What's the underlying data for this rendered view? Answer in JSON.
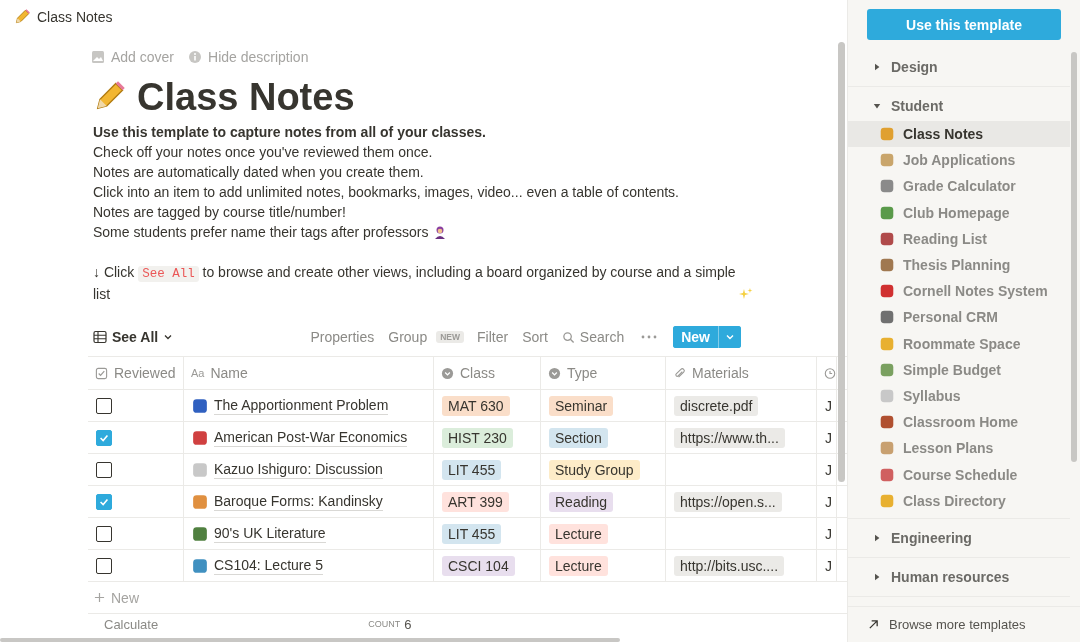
{
  "breadcrumb": {
    "title": "Class Notes"
  },
  "page_actions": [
    "Add cover",
    "Hide description"
  ],
  "page": {
    "title": "Class Notes",
    "description": [
      {
        "kind": "bold",
        "text": "Use this template to capture notes from all of your classes."
      },
      {
        "kind": "plain",
        "text": "Check off your notes once you've reviewed them once."
      },
      {
        "kind": "plain",
        "text": "Notes are automatically dated when you create them."
      },
      {
        "kind": "plain",
        "text": "Click into an item to add unlimited notes, bookmarks, images, video... even a table of contents."
      },
      {
        "kind": "plain",
        "text": "Notes are tagged by course title/number!"
      },
      {
        "kind": "emoji",
        "text": "Some students prefer name their tags after professors"
      },
      {
        "kind": "gap"
      },
      {
        "kind": "code",
        "before": "↓ Click",
        "code": "See All",
        "after": "to browse and create other views, including a board organized by course and a simple list"
      }
    ]
  },
  "view": {
    "name": "See All",
    "toolbar": [
      "Properties",
      "Group",
      "Filter",
      "Sort",
      "Search"
    ],
    "group_badge": "NEW",
    "new_button": "New"
  },
  "table": {
    "columns": [
      {
        "label": "Reviewed",
        "kind": "check"
      },
      {
        "label": "Name",
        "kind": "title",
        "icon_text": "Aa"
      },
      {
        "label": "Class",
        "kind": "select"
      },
      {
        "label": "Type",
        "kind": "select"
      },
      {
        "label": "Materials",
        "kind": "file"
      },
      {
        "kind": "date"
      }
    ],
    "rows": [
      {
        "checked": false,
        "name": "The Apportionment Problem",
        "class": {
          "text": "MAT 630",
          "color": "#fadec9"
        },
        "type": {
          "text": "Seminar",
          "color": "#fadec9"
        },
        "materials": "discrete.pdf",
        "column_5": "J"
      },
      {
        "checked": true,
        "name": "American Post-War Economics",
        "class": {
          "text": "HIST 230",
          "color": "#dbeddb"
        },
        "type": {
          "text": "Section",
          "color": "#d3e5ef"
        },
        "materials": "https://www.th...",
        "column_5": "J"
      },
      {
        "checked": false,
        "name": "Kazuo Ishiguro: Discussion",
        "class": {
          "text": "LIT 455",
          "color": "#d3e5ef"
        },
        "type": {
          "text": "Study Group",
          "color": "#fdecc8"
        },
        "materials": "",
        "column_5": "J"
      },
      {
        "checked": true,
        "name": "Baroque Forms: Kandinsky",
        "class": {
          "text": "ART 399",
          "color": "#ffe2dd"
        },
        "type": {
          "text": "Reading",
          "color": "#e8deee"
        },
        "materials": "https://open.s...",
        "column_5": "J"
      },
      {
        "checked": false,
        "name": "90's UK Literature",
        "class": {
          "text": "LIT 455",
          "color": "#d3e5ef"
        },
        "type": {
          "text": "Lecture",
          "color": "#ffe2dd"
        },
        "materials": "",
        "column_5": "J"
      },
      {
        "checked": false,
        "name": "CS104: Lecture 5",
        "class": {
          "text": "CSCI 104",
          "color": "#e8deee"
        },
        "type": {
          "text": "Lecture",
          "color": "#ffe2dd"
        },
        "materials": "http://bits.usc....",
        "column_5": "J"
      }
    ],
    "add_row": "New",
    "footer": {
      "calculate": "Calculate",
      "count_label": "COUNT",
      "count": "6"
    }
  },
  "sidebar": {
    "use_button": "Use this template",
    "sections": [
      {
        "label": "Design",
        "expanded": false
      },
      {
        "label": "Student",
        "expanded": true,
        "items": [
          {
            "label": "Class Notes",
            "selected": true
          },
          {
            "label": "Job Applications",
            "selected": false
          },
          {
            "label": "Grade Calculator",
            "selected": false
          },
          {
            "label": "Club Homepage",
            "selected": false
          },
          {
            "label": "Reading List",
            "selected": false
          },
          {
            "label": "Thesis Planning",
            "selected": false
          },
          {
            "label": "Cornell Notes System",
            "selected": false
          },
          {
            "label": "Personal CRM",
            "selected": false
          },
          {
            "label": "Roommate Space",
            "selected": false
          },
          {
            "label": "Simple Budget",
            "selected": false
          },
          {
            "label": "Syllabus",
            "selected": false
          },
          {
            "label": "Classroom Home",
            "selected": false
          },
          {
            "label": "Lesson Plans",
            "selected": false
          },
          {
            "label": "Course Schedule",
            "selected": false
          },
          {
            "label": "Class Directory",
            "selected": false
          }
        ]
      },
      {
        "label": "Engineering",
        "expanded": false
      },
      {
        "label": "Human resources",
        "expanded": false
      }
    ],
    "browse": "Browse more templates"
  }
}
